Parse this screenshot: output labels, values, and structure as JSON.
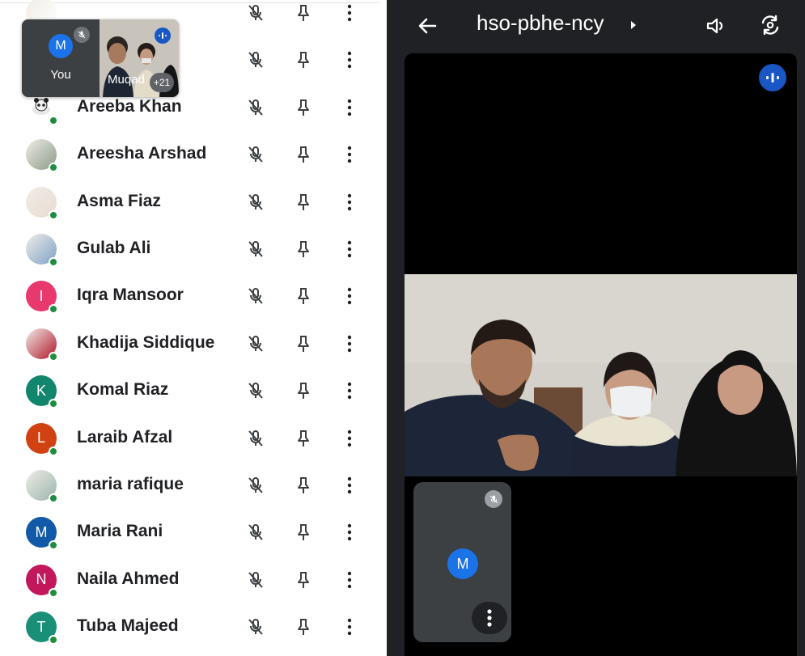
{
  "left_panel": {
    "pip": {
      "self_initial": "M",
      "self_label": "You",
      "other_label": "Muqad",
      "more_count": "+21"
    },
    "participants": [
      {
        "name": "",
        "initial": "",
        "color": "#ffffff",
        "avatar": "photo-top"
      },
      {
        "name": "",
        "initial": "",
        "color": "#ffffff",
        "avatar": "photo-top"
      },
      {
        "name": "Areeba Khan",
        "initial": "",
        "color": "#ffffff",
        "avatar": "panda-photo"
      },
      {
        "name": "Areesha Arshad",
        "initial": "",
        "color": "#8a9a88",
        "avatar": "photo"
      },
      {
        "name": "Asma Fiaz",
        "initial": "",
        "color": "#e8dcd2",
        "avatar": "photo"
      },
      {
        "name": "Gulab Ali",
        "initial": "",
        "color": "#7ea2c8",
        "avatar": "photo"
      },
      {
        "name": "Iqra Mansoor",
        "initial": "I",
        "color": "#e8396f",
        "avatar": "letter"
      },
      {
        "name": "Khadija Siddique",
        "initial": "",
        "color": "#b0172b",
        "avatar": "photo"
      },
      {
        "name": "Komal Riaz",
        "initial": "K",
        "color": "#12866c",
        "avatar": "letter"
      },
      {
        "name": "Laraib Afzal",
        "initial": "L",
        "color": "#d14213",
        "avatar": "letter"
      },
      {
        "name": "maria rafique",
        "initial": "",
        "color": "#9ab5ad",
        "avatar": "photo"
      },
      {
        "name": "Maria Rani",
        "initial": "M",
        "color": "#1259a8",
        "avatar": "letter"
      },
      {
        "name": "Naila Ahmed",
        "initial": "N",
        "color": "#c2185b",
        "avatar": "letter"
      },
      {
        "name": "Tuba Majeed",
        "initial": "T",
        "color": "#1a8f78",
        "avatar": "letter"
      }
    ]
  },
  "right_panel": {
    "meeting_code": "hso-pbhe-ncy",
    "self_initial": "M"
  },
  "colors": {
    "dark_bg": "#202124",
    "accent_blue": "#1a73e8",
    "speaking_blue": "#1a57c4",
    "online_green": "#1e8e3e"
  }
}
